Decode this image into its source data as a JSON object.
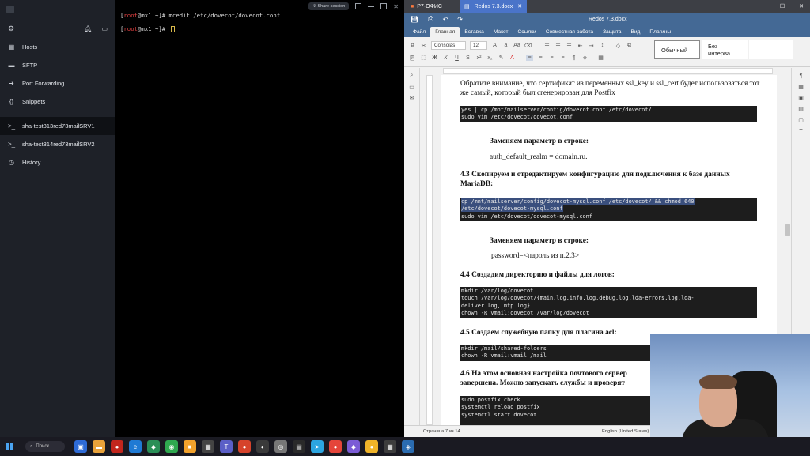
{
  "ssh_app": {
    "nav": [
      {
        "label": "Hosts",
        "icon": "server-icon"
      },
      {
        "label": "SFTP",
        "icon": "folder-icon"
      },
      {
        "label": "Port Forwarding",
        "icon": "arrow-right-icon"
      },
      {
        "label": "Snippets",
        "icon": "braces-icon"
      }
    ],
    "sessions": [
      {
        "label": "sha-test313red73mailSRV1",
        "active": true
      },
      {
        "label": "sha-test314red73mailSRV2",
        "active": false
      }
    ],
    "history_label": "History",
    "share_session_label": "Share session"
  },
  "terminal": {
    "line1": {
      "user": "root",
      "host": "@mx1",
      "path": " ~]# ",
      "cmd": "mcedit /etc/dovecot/dovecot.conf"
    },
    "line2": {
      "user": "root",
      "host": "@mx1",
      "path": " ~]# "
    }
  },
  "office": {
    "app_name": "Р7-ОФИС",
    "tab_title": "Redos 7.3.docx",
    "doc_title": "Redos 7.3.docx",
    "menu": [
      "Файл",
      "Главная",
      "Вставка",
      "Макет",
      "Ссылки",
      "Совместная работа",
      "Защита",
      "Вид",
      "Плагины"
    ],
    "active_menu": "Главная",
    "font_name": "Consolas",
    "font_size": "12",
    "styles": [
      "Обычный",
      "Без интерва"
    ],
    "status": {
      "page": "Страница 7 из 14",
      "lang": "English (United States)"
    }
  },
  "document": {
    "p1": "Обратите внимание, что сертификат из переменных ssl_key и ssl_cert будет использоваться тот же самый, который был сгенерирован для Postfix",
    "code1": "yes | cp /mnt/mailserver/config/dovecot.conf /etc/dovecot/\nsudo vim /etc/dovecot/dovecot.conf",
    "h_replace1": "Заменяем параметр в строке:",
    "v_replace1": "auth_default_realm = domain.ru.",
    "h43": "4.3 Скопируем и отредактируем конфигурацию для подключения к базе данных MariaDB:",
    "code2_hl": "cp /mnt/mailserver/config/dovecot-mysql.conf /etc/dovecot/ && chmod 640\n/etc/dovecot/dovecot-mysql.conf",
    "code2_rest": "sudo vim /etc/dovecot/dovecot-mysql.conf",
    "h_replace2": "Заменяем параметр в строке:",
    "v_replace2": "password=<пароль из п.2.3>",
    "h44": "4.4 Создадим директорию и файлы для логов:",
    "code3": "mkdir /var/log/dovecot\ntouch /var/log/dovecot/{main.log,info.log,debug.log,lda-errors.log,lda-\ndeliver.log,lmtp.log}\nchown -R vmail:dovecot /var/log/dovecot",
    "h45": "4.5 Создаем служебную папку для плагина acl:",
    "code4": "mkdir /mail/shared-folders\nchown -R vmail:vmail /mail",
    "h46": "4.6 На этом основная настройка почтового сервер завершена. Можно запускать службы и проверят",
    "code5": "sudo postfix check\nsystemctl reload postfix\nsystemctl start dovecot\n                    "
  },
  "taskbar": {
    "search_label": "Поиск"
  },
  "colors": {
    "office_blue": "#446995",
    "terminal_bg": "#000000",
    "sidebar_bg": "#1e2128",
    "prompt_red": "#e04040"
  }
}
